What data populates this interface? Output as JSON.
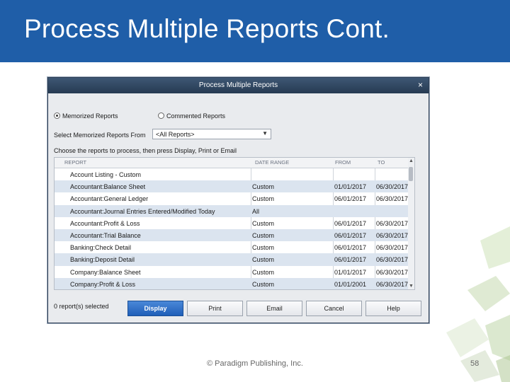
{
  "slide": {
    "title": "Process Multiple Reports Cont.",
    "footer": "© Paradigm Publishing, Inc.",
    "page_number": "58"
  },
  "dialog": {
    "title": "Process Multiple Reports",
    "close_icon": "×",
    "radio_memorized": "Memorized Reports",
    "radio_commented": "Commented Reports",
    "select_label": "Select Memorized Reports From",
    "select_value": "<All Reports>",
    "instruction": "Choose the reports to process, then press Display, Print or Email",
    "columns": [
      "REPORT",
      "DATE RANGE",
      "FROM",
      "TO"
    ],
    "rows": [
      {
        "report": "Account Listing - Custom",
        "range": "",
        "from": "",
        "to": ""
      },
      {
        "report": "Accountant:Balance Sheet",
        "range": "Custom",
        "from": "01/01/2017",
        "to": "06/30/2017"
      },
      {
        "report": "Accountant:General Ledger",
        "range": "Custom",
        "from": "06/01/2017",
        "to": "06/30/2017"
      },
      {
        "report": "Accountant:Journal Entries Entered/Modified Today",
        "range": "All",
        "from": "",
        "to": ""
      },
      {
        "report": "Accountant:Profit & Loss",
        "range": "Custom",
        "from": "06/01/2017",
        "to": "06/30/2017"
      },
      {
        "report": "Accountant:Trial Balance",
        "range": "Custom",
        "from": "06/01/2017",
        "to": "06/30/2017"
      },
      {
        "report": "Banking:Check Detail",
        "range": "Custom",
        "from": "06/01/2017",
        "to": "06/30/2017"
      },
      {
        "report": "Banking:Deposit Detail",
        "range": "Custom",
        "from": "06/01/2017",
        "to": "06/30/2017"
      },
      {
        "report": "Company:Balance Sheet",
        "range": "Custom",
        "from": "01/01/2017",
        "to": "06/30/2017"
      },
      {
        "report": "Company:Profit & Loss",
        "range": "Custom",
        "from": "01/01/2001",
        "to": "06/30/2017"
      }
    ],
    "selected_count": "0 report(s) selected",
    "buttons": {
      "display": "Display",
      "print": "Print",
      "email": "Email",
      "cancel": "Cancel",
      "help": "Help"
    },
    "colors": {
      "accent": "#1f5ea8",
      "titlebar": "#263a52",
      "row_alt": "#dbe4ef"
    }
  }
}
